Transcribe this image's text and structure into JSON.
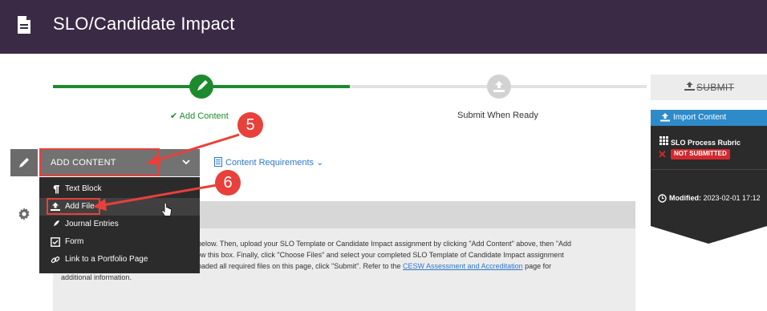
{
  "header": {
    "title": "SLO/Candidate Impact",
    "icon": "document-icon"
  },
  "progress": {
    "steps": [
      {
        "label": "✔ Add Content",
        "state": "complete"
      },
      {
        "label": "Submit When Ready",
        "state": "pending"
      }
    ]
  },
  "submit": {
    "label": "SUBMIT"
  },
  "toolbar": {
    "add_content_label": "ADD CONTENT",
    "content_requirements_label": "Content Requirements ⌄"
  },
  "add_menu": {
    "items": [
      {
        "label": "Text Block",
        "icon": "paragraph-icon"
      },
      {
        "label": "Add File",
        "icon": "upload-icon"
      },
      {
        "label": "Journal Entries",
        "icon": "quill-icon"
      },
      {
        "label": "Form",
        "icon": "checkbox-icon"
      },
      {
        "label": "Link to a Portfolio Page",
        "icon": "link-icon"
      }
    ]
  },
  "side_panel": {
    "import_label": "Import Content",
    "rubric_label": "SLO Process Rubric",
    "status_badge": "NOT SUBMITTED",
    "modified_label": "Modified:",
    "modified_value": "2023-02-01 17:12"
  },
  "content": {
    "line1": "rm below.  Then, upload your SLO Template or Candidate Impact assignment by clicking \"Add Content\" above, then \"Add",
    "line2": "below this box.  Finally, click \"Choose Files\" and select your completed SLO Template of Candidate Impact assignment",
    "line3_pre": "ploaded all required files on this page, click \"Submit\".  Refer to the ",
    "line3_link": "CESW Assessment and Accreditation",
    "line3_post": " page for",
    "line4": "additional information."
  },
  "annotations": {
    "step5": "5",
    "step6": "6"
  },
  "colors": {
    "header_bg": "#3b2a45",
    "progress_done": "#1e8a2e",
    "accent_blue": "#2d8bc9",
    "annotation_red": "#e8403a",
    "error_red": "#d3282e"
  }
}
